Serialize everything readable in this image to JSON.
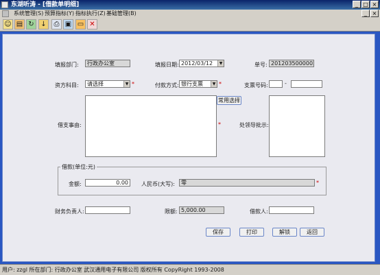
{
  "window": {
    "title": "东湖听涛 - [借款单明细]",
    "min_label": "_",
    "max_label": "□",
    "close_label": "×"
  },
  "menu": [
    {
      "label": "系统管理(S)"
    },
    {
      "label": "预算指标(Y)"
    },
    {
      "label": "指标执行(Z)"
    },
    {
      "label": "基础管理(B)"
    }
  ],
  "mdi_buttons": {
    "min_label": "_",
    "close_label": "×"
  },
  "toolbar": {
    "icons": [
      "tool-1",
      "tool-2",
      "tool-3",
      "tool-4",
      "tool-5",
      "tool-6",
      "tool-7",
      "close"
    ]
  },
  "form": {
    "dept_label": "填报部门:",
    "dept_value": "行政办公室",
    "date_label": "填报日期:",
    "date_value": "2012/03/12",
    "doc_no_label": "单号:",
    "doc_no_value": "2012035000002",
    "fund_label": "资方科目:",
    "fund_value": "请选择",
    "pay_method_label": "付款方式:",
    "pay_method_value": "银行支票",
    "check_no_label": "支票号码:",
    "check_no_prefix": "",
    "check_no_separator": "-",
    "check_no_value": "",
    "common_select_label": "常用选择",
    "reason_label": "借支事由:",
    "leader_opinion_label": "处领导批示:",
    "amount_group_label": "借款(单位:元)",
    "amount_label": "金额:",
    "amount_value": "0.00",
    "rmb_upper_label": "人民币(大写):",
    "rmb_upper_value": "零",
    "finance_head_label": "财务负责人:",
    "finance_head_value": "",
    "limit_label": "限额:",
    "limit_value": "5,000.00",
    "borrower_label": "借款人:",
    "borrower_value": "",
    "required_mark": "*"
  },
  "actions": {
    "save": "保存",
    "print": "打印",
    "unlock": "解锁",
    "back": "返回"
  },
  "status": {
    "text": "用户: zzgl  所在部门: 行政办公室  武汉通用电子有限公司 版权所有 CopyRight  1993-2008"
  }
}
